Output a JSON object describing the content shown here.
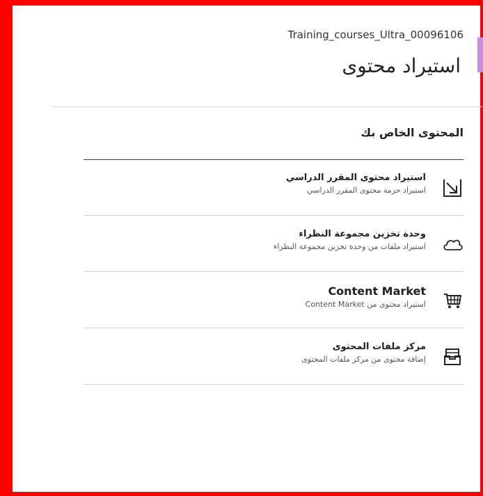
{
  "header": {
    "course_id": "Training_courses_Ultra_00096106",
    "title": "استيراد محتوى"
  },
  "section": {
    "title": "المحتوى الخاص بك"
  },
  "items": [
    {
      "label": "استيراد محتوى المقرر الدراسي",
      "description": "استيراد حزمة محتوى المقرر الدراسي",
      "icon": "import-arrow-icon"
    },
    {
      "label": "وحدة تخزين مجموعة النظراء",
      "description": "استيراد ملفات من وحدة تخزين مجموعة النظراء",
      "icon": "cloud-icon"
    },
    {
      "label": "Content Market",
      "description": "استيراد محتوى من Content Market",
      "icon": "cart-icon"
    },
    {
      "label": "مركز ملفات المحتوى",
      "description": "إضافة محتوى من مركز ملفات المحتوى",
      "icon": "inbox-tray-icon"
    }
  ],
  "colors": {
    "frame": "#ff0000",
    "accent": "#c98ee0"
  }
}
